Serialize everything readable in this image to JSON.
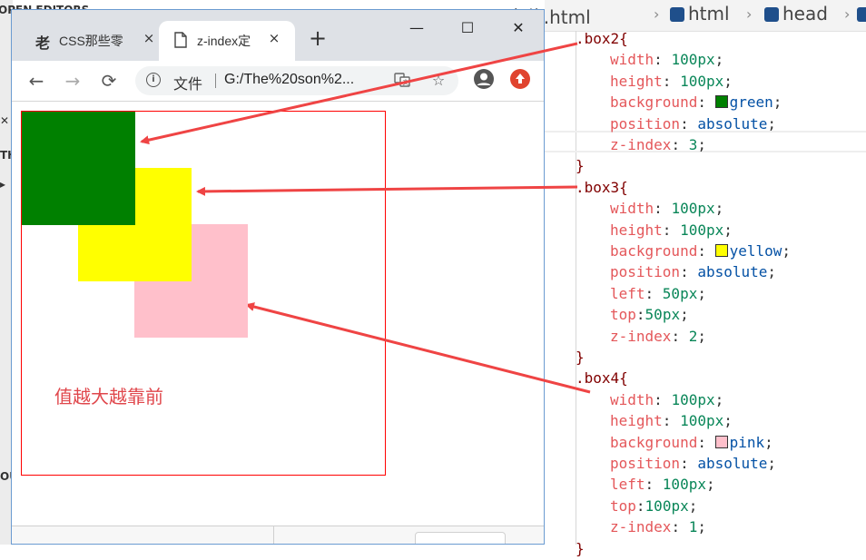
{
  "editor": {
    "sidebar_text_top": "OPEN EDITORS",
    "breadcrumb": {
      "file": "index定位.html",
      "crumbs": [
        "html",
        "head"
      ]
    },
    "code_lines": [
      {
        "sel": ".box2{"
      },
      {
        "prop": "width",
        "val": "100px",
        "type": "num"
      },
      {
        "prop": "height",
        "val": "100px",
        "type": "num"
      },
      {
        "prop": "background",
        "val": "green",
        "type": "color",
        "color": "#008000"
      },
      {
        "prop": "position",
        "val": "absolute",
        "type": "kw"
      },
      {
        "prop": "z-index",
        "val": "3",
        "type": "num"
      },
      {
        "sel": "}"
      },
      {
        "sel": ".box3{"
      },
      {
        "prop": "width",
        "val": "100px",
        "type": "num"
      },
      {
        "prop": "height",
        "val": "100px",
        "type": "num"
      },
      {
        "prop": "background",
        "val": "yellow",
        "type": "color",
        "color": "#ffff00"
      },
      {
        "prop": "position",
        "val": "absolute",
        "type": "kw"
      },
      {
        "prop": "left",
        "val": "50px",
        "type": "num"
      },
      {
        "prop": "top",
        "val": "50px",
        "type": "num",
        "nospace": true
      },
      {
        "prop": "z-index",
        "val": "2",
        "type": "num"
      },
      {
        "sel": "}"
      },
      {
        "sel": ".box4{"
      },
      {
        "prop": "width",
        "val": "100px",
        "type": "num"
      },
      {
        "prop": "height",
        "val": "100px",
        "type": "num"
      },
      {
        "prop": "background",
        "val": "pink",
        "type": "color",
        "color": "#ffc0cb"
      },
      {
        "prop": "position",
        "val": "absolute",
        "type": "kw"
      },
      {
        "prop": "left",
        "val": "100px",
        "type": "num"
      },
      {
        "prop": "top",
        "val": "100px",
        "type": "num",
        "nospace": true
      },
      {
        "prop": "z-index",
        "val": "1",
        "type": "num"
      },
      {
        "sel": "}"
      }
    ]
  },
  "browser": {
    "tabs": [
      {
        "favicon_text": "老",
        "title": "CSS那些零",
        "close": "×"
      },
      {
        "title": "z-index定",
        "close": "×"
      }
    ],
    "new_tab": "+",
    "window_controls": {
      "minimize": "—",
      "maximize": "☐",
      "close": "✕"
    },
    "toolbar": {
      "back": "←",
      "forward": "→",
      "reload": "⟳",
      "info": "i",
      "scheme_label": "文件",
      "url": "G:/The%20son%2..."
    },
    "page": {
      "caption": "值越大越靠前",
      "boxes": [
        {
          "name": "box2",
          "color": "#008000",
          "z": 3
        },
        {
          "name": "box3",
          "color": "#ffff00",
          "z": 2
        },
        {
          "name": "box4",
          "color": "#ffc0cb",
          "z": 1
        }
      ],
      "border_color": "#ff0000"
    }
  },
  "annotation": {
    "arrow_color": "#ef4444"
  }
}
